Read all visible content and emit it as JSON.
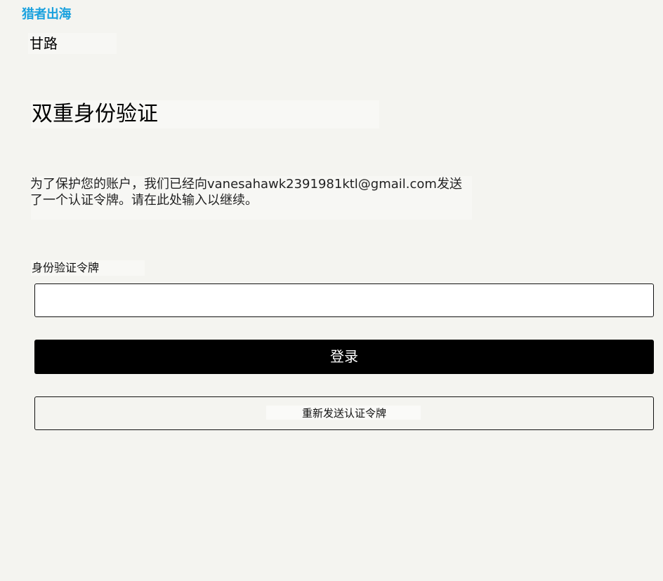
{
  "brand": {
    "logo_text": "猎者出海",
    "accent_color": "#1aa1de"
  },
  "store": {
    "name": "甘路"
  },
  "page": {
    "title": "双重身份验证",
    "description": "为了保护您的账户，我们已经向vanesahawk2391981ktl@gmail.com发送了一个认证令牌。请在此处输入以继续。"
  },
  "form": {
    "token_label": "身份验证令牌",
    "token_value": "",
    "login_label": "登录",
    "resend_label": "重新发送认证令牌"
  }
}
